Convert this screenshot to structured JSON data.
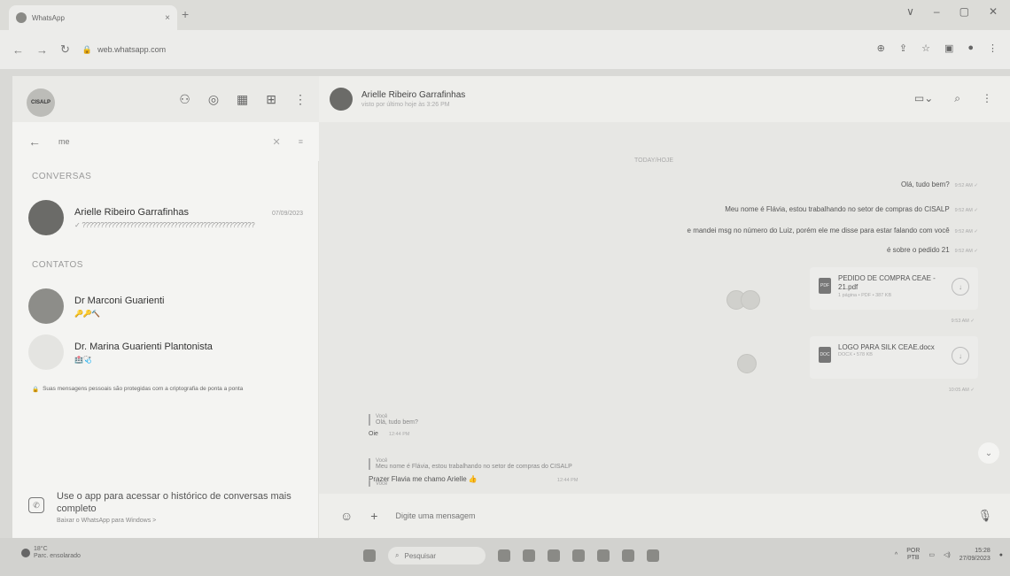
{
  "browser": {
    "tab_title": "WhatsApp",
    "tab_close": "×",
    "new_tab": "+",
    "url": "web.whatsapp.com",
    "window_controls": [
      "∨",
      "–",
      "▢",
      "✕"
    ]
  },
  "sidebar": {
    "logo_text": "CISALP",
    "search_value": "me",
    "sections": {
      "conversations": "CONVERSAS",
      "contacts": "CONTATOS"
    },
    "conversations": [
      {
        "name": "Arielle Ribeiro Garrafinhas",
        "date": "07/09/2023",
        "preview": "✓ ???????????????????????????????????????????????"
      }
    ],
    "contacts": [
      {
        "name": "Dr Marconi Guarienti",
        "status": "🔑🔑🔨"
      },
      {
        "name": "Dr. Marina Guarienti Plantonista",
        "status": "🏥🩺"
      }
    ],
    "privacy_note": "Suas mensagens pessoais são protegidas com a criptografia de ponta a ponta",
    "promo": {
      "title": "Use o app para acessar o histórico de conversas mais completo",
      "link": "Baixar o WhatsApp para Windows  >"
    }
  },
  "chat": {
    "contact_name": "Arielle Ribeiro Garrafinhas",
    "contact_status": "visto por último hoje às 3:26 PM",
    "date_label": "TODAY/HOJE",
    "outgoing": [
      {
        "text": "Olá, tudo bem?",
        "time": "9:52 AM ✓"
      },
      {
        "text": "Meu nome é Flávia, estou trabalhando no setor de compras do CISALP",
        "time": "9:52 AM ✓"
      },
      {
        "text": "e mandei msg no número do Luiz, porém ele me disse para estar falando com você",
        "time": "9:52 AM ✓"
      },
      {
        "text": "é sobre o pedido 21",
        "time": "9:52 AM ✓"
      }
    ],
    "documents": [
      {
        "name": "PEDIDO DE COMPRA CEAE - 21.pdf",
        "meta": "1 página • PDF • 387 KB",
        "type": "PDF",
        "time": "9:53 AM ✓"
      },
      {
        "name": "LOGO PARA SILK CEAE.docx",
        "meta": "DOCX • 578 KB",
        "type": "DOC",
        "time": "10:05 AM ✓"
      }
    ],
    "incoming": [
      {
        "quote_author": "Você",
        "quote_text": "Olá, tudo bem?",
        "text": "Oie",
        "time": "12:44 PM"
      },
      {
        "quote_author": "Você",
        "quote_text": "Meu nome é Flávia, estou trabalhando no setor de compras do CISALP",
        "text": "Prazer Flavia me chamo Arielle 👍",
        "time": "12:44 PM"
      },
      {
        "quote_author": "Você",
        "quote_text": "",
        "text": "",
        "time": ""
      }
    ],
    "composer_placeholder": "Digite uma mensagem"
  },
  "taskbar": {
    "weather_temp": "18°C",
    "weather_desc": "Parc. ensolarado",
    "search_placeholder": "Pesquisar",
    "lang_top": "POR",
    "lang_bottom": "PTB",
    "time": "15:28",
    "date": "27/09/2023"
  },
  "colors": {
    "background": "#f0f0ee",
    "chat_bg": "#e7e7e4"
  }
}
